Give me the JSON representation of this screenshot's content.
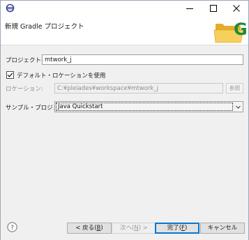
{
  "window": {
    "icon": "eclipse-icon",
    "controls": {
      "minimize": "minimize-icon",
      "maximize": "maximize-icon",
      "close": "close-icon"
    }
  },
  "header": {
    "title": "新規 Gradle プロジェクト",
    "logo": "gradle-folder-icon"
  },
  "form": {
    "project_name_label": "プロジェクト名:",
    "project_name_value": "mtwork_j",
    "default_location_checkbox_label": "デフォルト・ロケーションを使用",
    "default_location_checked": true,
    "location_label": "ロケーション:",
    "location_value": "C:¥pleiades¥workspace¥mtwork_j",
    "browse_button_label": "参照",
    "sample_project_label": "サンプル・プロジェクト:",
    "sample_project_value": "Java Quickstart"
  },
  "footer": {
    "help_icon": "help-icon",
    "back_label_pre": "< 戻る(",
    "back_mnemonic": "B",
    "back_label_post": ")",
    "next_label_pre": "次へ(",
    "next_mnemonic": "N",
    "next_label_post": ") >",
    "finish_label_pre": "完了(",
    "finish_mnemonic": "F",
    "finish_label_post": ")",
    "cancel_label": "キャンセル"
  },
  "colors": {
    "accent": "#0078d7",
    "checkbox_check": "#222222",
    "logo_folder": "#f3c548",
    "logo_letter": "#1f8a3a"
  }
}
